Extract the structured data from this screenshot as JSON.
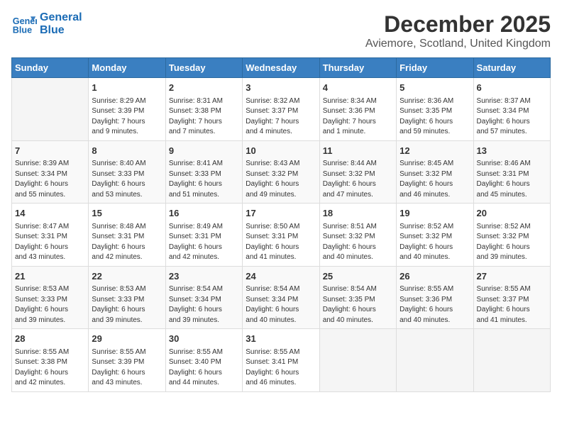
{
  "header": {
    "logo_line1": "General",
    "logo_line2": "Blue",
    "month_title": "December 2025",
    "location": "Aviemore, Scotland, United Kingdom"
  },
  "days_of_week": [
    "Sunday",
    "Monday",
    "Tuesday",
    "Wednesday",
    "Thursday",
    "Friday",
    "Saturday"
  ],
  "weeks": [
    [
      {
        "day": "",
        "info": ""
      },
      {
        "day": "1",
        "info": "Sunrise: 8:29 AM\nSunset: 3:39 PM\nDaylight: 7 hours\nand 9 minutes."
      },
      {
        "day": "2",
        "info": "Sunrise: 8:31 AM\nSunset: 3:38 PM\nDaylight: 7 hours\nand 7 minutes."
      },
      {
        "day": "3",
        "info": "Sunrise: 8:32 AM\nSunset: 3:37 PM\nDaylight: 7 hours\nand 4 minutes."
      },
      {
        "day": "4",
        "info": "Sunrise: 8:34 AM\nSunset: 3:36 PM\nDaylight: 7 hours\nand 1 minute."
      },
      {
        "day": "5",
        "info": "Sunrise: 8:36 AM\nSunset: 3:35 PM\nDaylight: 6 hours\nand 59 minutes."
      },
      {
        "day": "6",
        "info": "Sunrise: 8:37 AM\nSunset: 3:34 PM\nDaylight: 6 hours\nand 57 minutes."
      }
    ],
    [
      {
        "day": "7",
        "info": "Sunrise: 8:39 AM\nSunset: 3:34 PM\nDaylight: 6 hours\nand 55 minutes."
      },
      {
        "day": "8",
        "info": "Sunrise: 8:40 AM\nSunset: 3:33 PM\nDaylight: 6 hours\nand 53 minutes."
      },
      {
        "day": "9",
        "info": "Sunrise: 8:41 AM\nSunset: 3:33 PM\nDaylight: 6 hours\nand 51 minutes."
      },
      {
        "day": "10",
        "info": "Sunrise: 8:43 AM\nSunset: 3:32 PM\nDaylight: 6 hours\nand 49 minutes."
      },
      {
        "day": "11",
        "info": "Sunrise: 8:44 AM\nSunset: 3:32 PM\nDaylight: 6 hours\nand 47 minutes."
      },
      {
        "day": "12",
        "info": "Sunrise: 8:45 AM\nSunset: 3:32 PM\nDaylight: 6 hours\nand 46 minutes."
      },
      {
        "day": "13",
        "info": "Sunrise: 8:46 AM\nSunset: 3:31 PM\nDaylight: 6 hours\nand 45 minutes."
      }
    ],
    [
      {
        "day": "14",
        "info": "Sunrise: 8:47 AM\nSunset: 3:31 PM\nDaylight: 6 hours\nand 43 minutes."
      },
      {
        "day": "15",
        "info": "Sunrise: 8:48 AM\nSunset: 3:31 PM\nDaylight: 6 hours\nand 42 minutes."
      },
      {
        "day": "16",
        "info": "Sunrise: 8:49 AM\nSunset: 3:31 PM\nDaylight: 6 hours\nand 42 minutes."
      },
      {
        "day": "17",
        "info": "Sunrise: 8:50 AM\nSunset: 3:31 PM\nDaylight: 6 hours\nand 41 minutes."
      },
      {
        "day": "18",
        "info": "Sunrise: 8:51 AM\nSunset: 3:32 PM\nDaylight: 6 hours\nand 40 minutes."
      },
      {
        "day": "19",
        "info": "Sunrise: 8:52 AM\nSunset: 3:32 PM\nDaylight: 6 hours\nand 40 minutes."
      },
      {
        "day": "20",
        "info": "Sunrise: 8:52 AM\nSunset: 3:32 PM\nDaylight: 6 hours\nand 39 minutes."
      }
    ],
    [
      {
        "day": "21",
        "info": "Sunrise: 8:53 AM\nSunset: 3:33 PM\nDaylight: 6 hours\nand 39 minutes."
      },
      {
        "day": "22",
        "info": "Sunrise: 8:53 AM\nSunset: 3:33 PM\nDaylight: 6 hours\nand 39 minutes."
      },
      {
        "day": "23",
        "info": "Sunrise: 8:54 AM\nSunset: 3:34 PM\nDaylight: 6 hours\nand 39 minutes."
      },
      {
        "day": "24",
        "info": "Sunrise: 8:54 AM\nSunset: 3:34 PM\nDaylight: 6 hours\nand 40 minutes."
      },
      {
        "day": "25",
        "info": "Sunrise: 8:54 AM\nSunset: 3:35 PM\nDaylight: 6 hours\nand 40 minutes."
      },
      {
        "day": "26",
        "info": "Sunrise: 8:55 AM\nSunset: 3:36 PM\nDaylight: 6 hours\nand 40 minutes."
      },
      {
        "day": "27",
        "info": "Sunrise: 8:55 AM\nSunset: 3:37 PM\nDaylight: 6 hours\nand 41 minutes."
      }
    ],
    [
      {
        "day": "28",
        "info": "Sunrise: 8:55 AM\nSunset: 3:38 PM\nDaylight: 6 hours\nand 42 minutes."
      },
      {
        "day": "29",
        "info": "Sunrise: 8:55 AM\nSunset: 3:39 PM\nDaylight: 6 hours\nand 43 minutes."
      },
      {
        "day": "30",
        "info": "Sunrise: 8:55 AM\nSunset: 3:40 PM\nDaylight: 6 hours\nand 44 minutes."
      },
      {
        "day": "31",
        "info": "Sunrise: 8:55 AM\nSunset: 3:41 PM\nDaylight: 6 hours\nand 46 minutes."
      },
      {
        "day": "",
        "info": ""
      },
      {
        "day": "",
        "info": ""
      },
      {
        "day": "",
        "info": ""
      }
    ]
  ]
}
